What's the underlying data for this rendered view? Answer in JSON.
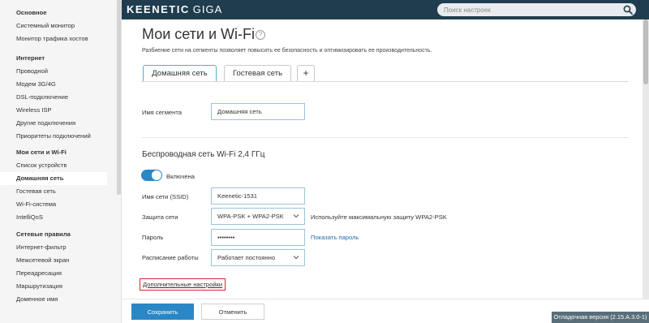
{
  "header": {
    "logo_brand": "KEENETIC",
    "logo_model": "GIGA",
    "search_placeholder": "Поиск настроек",
    "search_icon": "search-icon"
  },
  "sidebar": {
    "groups": [
      {
        "title": "Основное",
        "items": [
          "Системный монитор",
          "Монитор трафика хостов"
        ]
      },
      {
        "title": "Интернет",
        "items": [
          "Проводной",
          "Модем 3G/4G",
          "DSL-подключение",
          "Wireless ISP",
          "Другие подключения",
          "Приоритеты подключений"
        ]
      },
      {
        "title": "Мои сети и Wi-Fi",
        "items": [
          "Список устройств",
          "Домашняя сеть",
          "Гостевая сеть",
          "Wi-Fi-система",
          "IntelliQoS"
        ]
      },
      {
        "title": "Сетевые правила",
        "items": [
          "Интернет-фильтр",
          "Межсетевой экран",
          "Переадресация",
          "Маршрутизация",
          "Доменное имя"
        ]
      }
    ],
    "active_item": "Домашняя сеть"
  },
  "main": {
    "title": "Мои сети и Wi-Fi",
    "help_icon": "help-icon",
    "description": "Разбиение сети на сегменты позволяет повысить ее безопасность и оптимизировать ее производительность.",
    "tabs": [
      {
        "label": "Домашняя сеть",
        "active": true
      },
      {
        "label": "Гостевая сеть",
        "active": false
      },
      {
        "label": "+",
        "active": false
      }
    ],
    "segment": {
      "label": "Имя сегмента",
      "value": "Домашняя сеть"
    },
    "wifi_section_title": "Беспроводная сеть Wi-Fi 2,4 ГГц",
    "wifi_toggle": {
      "label": "Включена",
      "state": "on"
    },
    "ssid": {
      "label": "Имя сети (SSID)",
      "value": "Keenetic-1531"
    },
    "security": {
      "label": "Защита сети",
      "value": "WPA-PSK + WPA2-PSK",
      "hint": "Используйте максимальную защиту WPA2-PSK"
    },
    "password": {
      "label": "Пароль",
      "value": "••••••••",
      "show_link": "Показать пароль"
    },
    "schedule": {
      "label": "Расписание работы",
      "value": "Работает постоянно"
    },
    "advanced_link": "Дополнительные настройки"
  },
  "footer": {
    "save_label": "Сохранить",
    "cancel_label": "Отменить",
    "version": "Отладочная версия (2.15.A.3.0-1)"
  },
  "colors": {
    "header_bg": "#1f3d4f",
    "accent": "#2a87c6",
    "highlight_border": "#d7262d"
  }
}
